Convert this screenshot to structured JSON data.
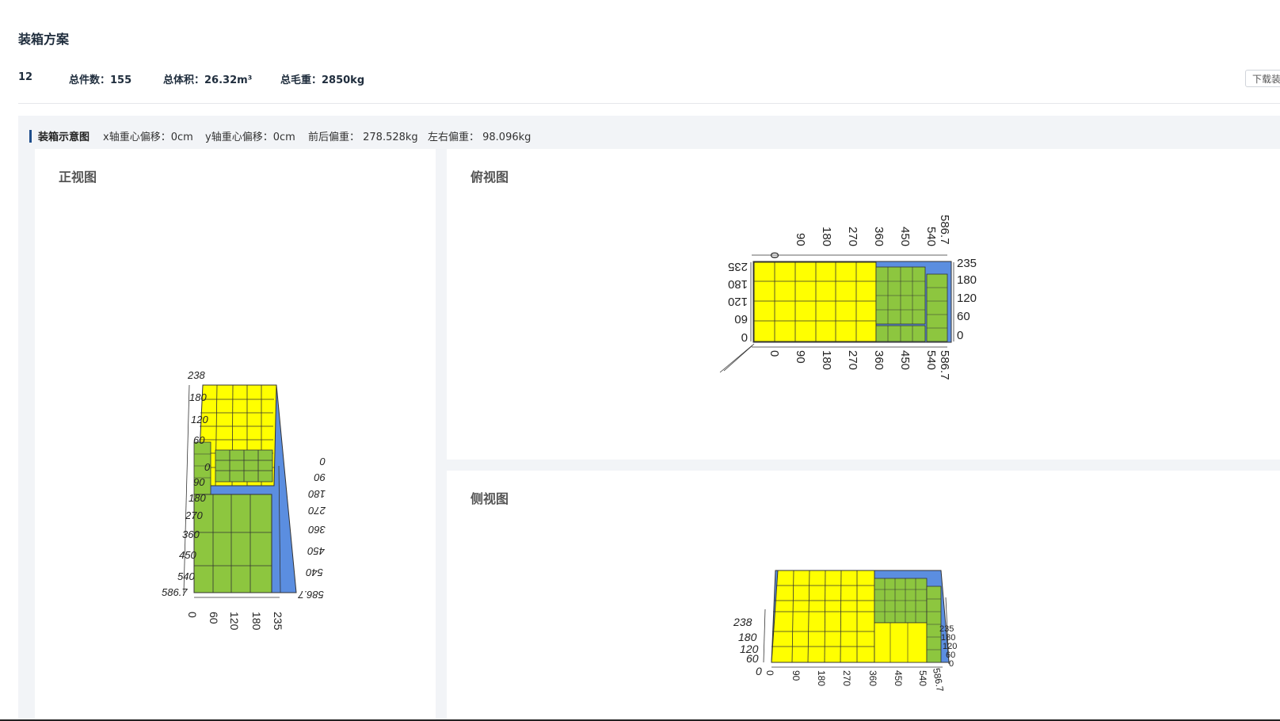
{
  "page": {
    "title": "装箱方案"
  },
  "summary": {
    "index": "12",
    "count": "总件数：155",
    "volume": "总体积：26.32m³",
    "weight": "总毛重：2850kg"
  },
  "toolbar": {
    "download_label": "下载装"
  },
  "diagram": {
    "title": "装箱示意图",
    "stats": {
      "x_offset": "x轴重心偏移：0cm",
      "y_offset": "y轴重心偏移：0cm",
      "front_back": "前后偏重：  278.528kg",
      "left_right": "左右偏重：  98.096kg"
    }
  },
  "views": {
    "front": {
      "title": "正视图"
    },
    "top": {
      "title": "俯视图"
    },
    "side": {
      "title": "侧视图"
    }
  },
  "colors": {
    "box_yellow": "#ffff00",
    "box_green": "#8dc63f",
    "container_blue": "#5b8ee0",
    "accent": "#1f4e8c"
  },
  "axis_labels": {
    "length": [
      "0",
      "90",
      "180",
      "270",
      "360",
      "450",
      "540",
      "586.7"
    ],
    "width": [
      "0",
      "60",
      "120",
      "180",
      "235"
    ],
    "height": [
      "0",
      "60",
      "120",
      "180",
      "238"
    ]
  }
}
